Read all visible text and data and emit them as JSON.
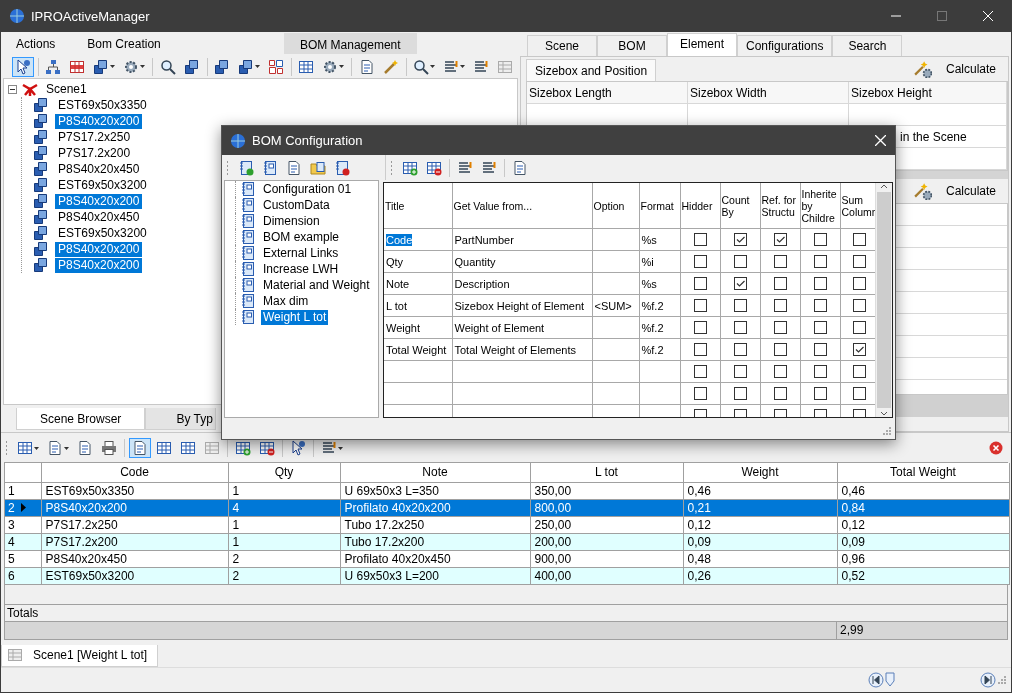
{
  "window": {
    "title": "IPROActiveManager"
  },
  "menu": [
    "Actions",
    "Bom Creation"
  ],
  "ribbon_tab": "BOM Management",
  "main_toolbar": [
    {
      "selected": true
    },
    {
      "selected": false
    },
    {
      "selected": false
    },
    {
      "selected": false
    },
    {
      "selected": false
    },
    {
      "selected": false
    },
    {
      "selected": false
    },
    {
      "selected": false
    },
    {
      "selected": false
    },
    {
      "selected": false
    },
    {
      "selected": false
    },
    {
      "selected": false
    },
    {
      "selected": false
    },
    {
      "selected": false
    },
    {
      "selected": false
    },
    {
      "selected": false
    },
    {
      "selected": false
    },
    {
      "selected": false
    }
  ],
  "scene_tree": {
    "label": "Scene1",
    "expanded": true,
    "children": [
      {
        "label": "EST69x50x3350",
        "selected": false
      },
      {
        "label": "P8S40x20x200",
        "selected": true
      },
      {
        "label": "P7S17.2x250",
        "selected": false
      },
      {
        "label": "P7S17.2x200",
        "selected": false
      },
      {
        "label": "P8S40x20x450",
        "selected": false
      },
      {
        "label": "EST69x50x3200",
        "selected": false
      },
      {
        "label": "P8S40x20x200",
        "selected": true
      },
      {
        "label": "P8S40x20x450",
        "selected": false
      },
      {
        "label": "EST69x50x3200",
        "selected": false
      },
      {
        "label": "P8S40x20x200",
        "selected": true
      },
      {
        "label": "P8S40x20x200",
        "selected": true
      }
    ]
  },
  "left_tabs": [
    {
      "label": "Scene Browser",
      "selected": true
    },
    {
      "label": "By Typ",
      "selected": false
    }
  ],
  "right_panel": {
    "tabs": [
      {
        "label": "Scene",
        "selected": false
      },
      {
        "label": "BOM",
        "selected": false
      },
      {
        "label": "Element",
        "selected": true
      },
      {
        "label": "Configurations",
        "selected": false
      },
      {
        "label": "Search",
        "selected": false
      }
    ],
    "subtab": "Sizebox and Position",
    "calculate_buttons": [
      "Calculate",
      "Calculate"
    ],
    "columns": [
      "Sizebox Length",
      "Sizebox Width",
      "Sizebox Height"
    ],
    "section_label": "in the Scene"
  },
  "bom_dialog": {
    "title": "BOM Configuration",
    "configurations": [
      {
        "label": "Configuration 01",
        "selected": false
      },
      {
        "label": "CustomData",
        "selected": false
      },
      {
        "label": "Dimension",
        "selected": false
      },
      {
        "label": "BOM example",
        "selected": false
      },
      {
        "label": "External Links",
        "selected": false
      },
      {
        "label": "Increase LWH",
        "selected": false
      },
      {
        "label": "Material and Weight",
        "selected": false
      },
      {
        "label": "Max dim",
        "selected": false
      },
      {
        "label": "Weight L tot",
        "selected": true
      }
    ],
    "columns": [
      "Title",
      "Get Value from...",
      "Option",
      "Format",
      "Hidder",
      "Count By",
      "Ref. for Structu",
      "Inherite by Childre",
      "Sum Columr"
    ],
    "rows": [
      {
        "title": "Code",
        "source": "PartNumber",
        "format": "%s",
        "selected": true,
        "hidden": false,
        "count_by": true,
        "structure_ref": true,
        "inherited": false,
        "sum_column": false
      },
      {
        "title": "Qty",
        "source": "Quantity",
        "format": "%i",
        "selected": false,
        "hidden": false,
        "count_by": false,
        "structure_ref": false,
        "inherited": false,
        "sum_column": false
      },
      {
        "title": "Note",
        "source": "Description",
        "format": "%s",
        "selected": false,
        "hidden": false,
        "count_by": true,
        "structure_ref": false,
        "inherited": false,
        "sum_column": false
      },
      {
        "title": "L tot",
        "source": "Sizebox Height of Element",
        "option": "<SUM>",
        "format": "%f.2",
        "selected": false,
        "hidden": false,
        "count_by": false,
        "structure_ref": false,
        "inherited": false,
        "sum_column": false
      },
      {
        "title": "Weight",
        "source": "Weight of Element",
        "format": "%f.2",
        "selected": false,
        "hidden": false,
        "count_by": false,
        "structure_ref": false,
        "inherited": false,
        "sum_column": false
      },
      {
        "title": "Total Weight",
        "source": "Total Weight of Elements",
        "format": "%f.2",
        "selected": false,
        "hidden": false,
        "count_by": false,
        "structure_ref": false,
        "inherited": false,
        "sum_column": true
      },
      {
        "selected": false,
        "hidden": false,
        "count_by": false,
        "structure_ref": false,
        "inherited": false,
        "sum_column": false
      },
      {
        "selected": false,
        "hidden": false,
        "count_by": false,
        "structure_ref": false,
        "inherited": false,
        "sum_column": false
      },
      {
        "selected": false,
        "hidden": false,
        "count_by": false,
        "structure_ref": false,
        "inherited": false,
        "sum_column": false
      }
    ]
  },
  "bottom_toolbar": [
    {
      "selected": false
    },
    {
      "selected": false
    },
    {
      "selected": false
    },
    {
      "selected": false
    },
    {
      "selected": true
    },
    {
      "selected": false
    },
    {
      "selected": false
    },
    {
      "selected": false
    },
    {
      "selected": false
    },
    {
      "selected": false
    },
    {
      "selected": false
    },
    {
      "selected": false
    }
  ],
  "bom_table": {
    "columns": [
      "Code",
      "Qty",
      "Note",
      "L tot",
      "Weight",
      "Total Weight"
    ],
    "rows": [
      {
        "number": "1",
        "selected": false,
        "cells": [
          "EST69x50x3350",
          "1",
          "U 69x50x3 L=350",
          "350,00",
          "0,46",
          "0,46"
        ]
      },
      {
        "number": "2",
        "selected": true,
        "cells": [
          "P8S40x20x200",
          "4",
          "Profilato 40x20x200",
          "800,00",
          "0,21",
          "0,84"
        ]
      },
      {
        "number": "3",
        "selected": false,
        "cells": [
          "P7S17.2x250",
          "1",
          "Tubo 17.2x250",
          "250,00",
          "0,12",
          "0,12"
        ]
      },
      {
        "number": "4",
        "selected": false,
        "cells": [
          "P7S17.2x200",
          "1",
          "Tubo 17.2x200",
          "200,00",
          "0,09",
          "0,09"
        ]
      },
      {
        "number": "5",
        "selected": false,
        "cells": [
          "P8S40x20x450",
          "2",
          "Profilato 40x20x450",
          "900,00",
          "0,48",
          "0,96"
        ]
      },
      {
        "number": "6",
        "selected": false,
        "cells": [
          "EST69x50x3200",
          "2",
          "U 69x50x3 L=200",
          "400,00",
          "0,26",
          "0,52"
        ]
      }
    ],
    "totals_label": "Totals",
    "total_weight": "2,99"
  },
  "document_tab": "Scene1 [Weight L tot]"
}
